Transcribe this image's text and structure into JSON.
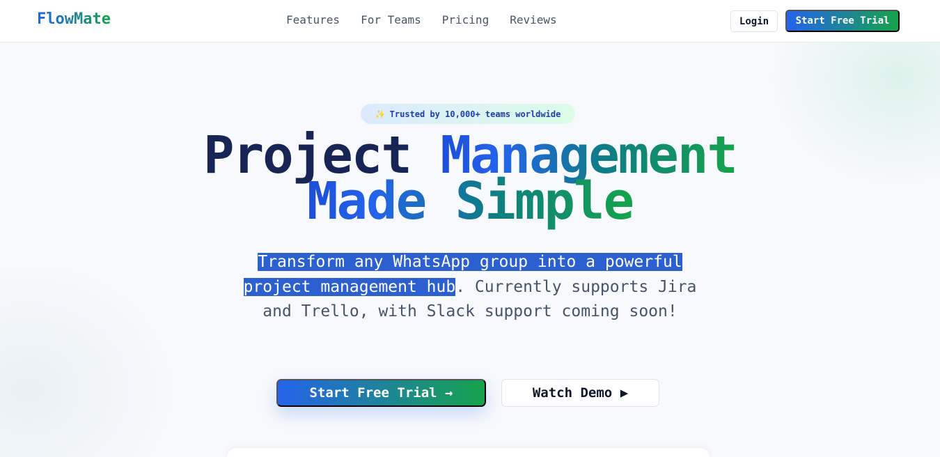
{
  "nav": {
    "logo": "FlowMate",
    "links": [
      "Features",
      "For Teams",
      "Pricing",
      "Reviews"
    ],
    "login_label": "Login",
    "trial_label": "Start Free Trial"
  },
  "hero": {
    "badge_icon": "✨",
    "badge_text": "Trusted by 10,000+ teams worldwide",
    "headline_part1": "Project ",
    "headline_part2": "Management",
    "headline_line2": "Made Simple",
    "subtitle_selected": "Transform any WhatsApp group into a powerful project management hub",
    "subtitle_rest": ". Currently supports Jira and Trello, with Slack support coming soon!",
    "cta_primary": "Start Free Trial →",
    "cta_secondary": "Watch Demo ▶"
  },
  "colors": {
    "brand_blue": "#2563eb",
    "brand_green": "#16a34a",
    "selection": "#2c5fd0",
    "heading_dark": "#172554"
  }
}
